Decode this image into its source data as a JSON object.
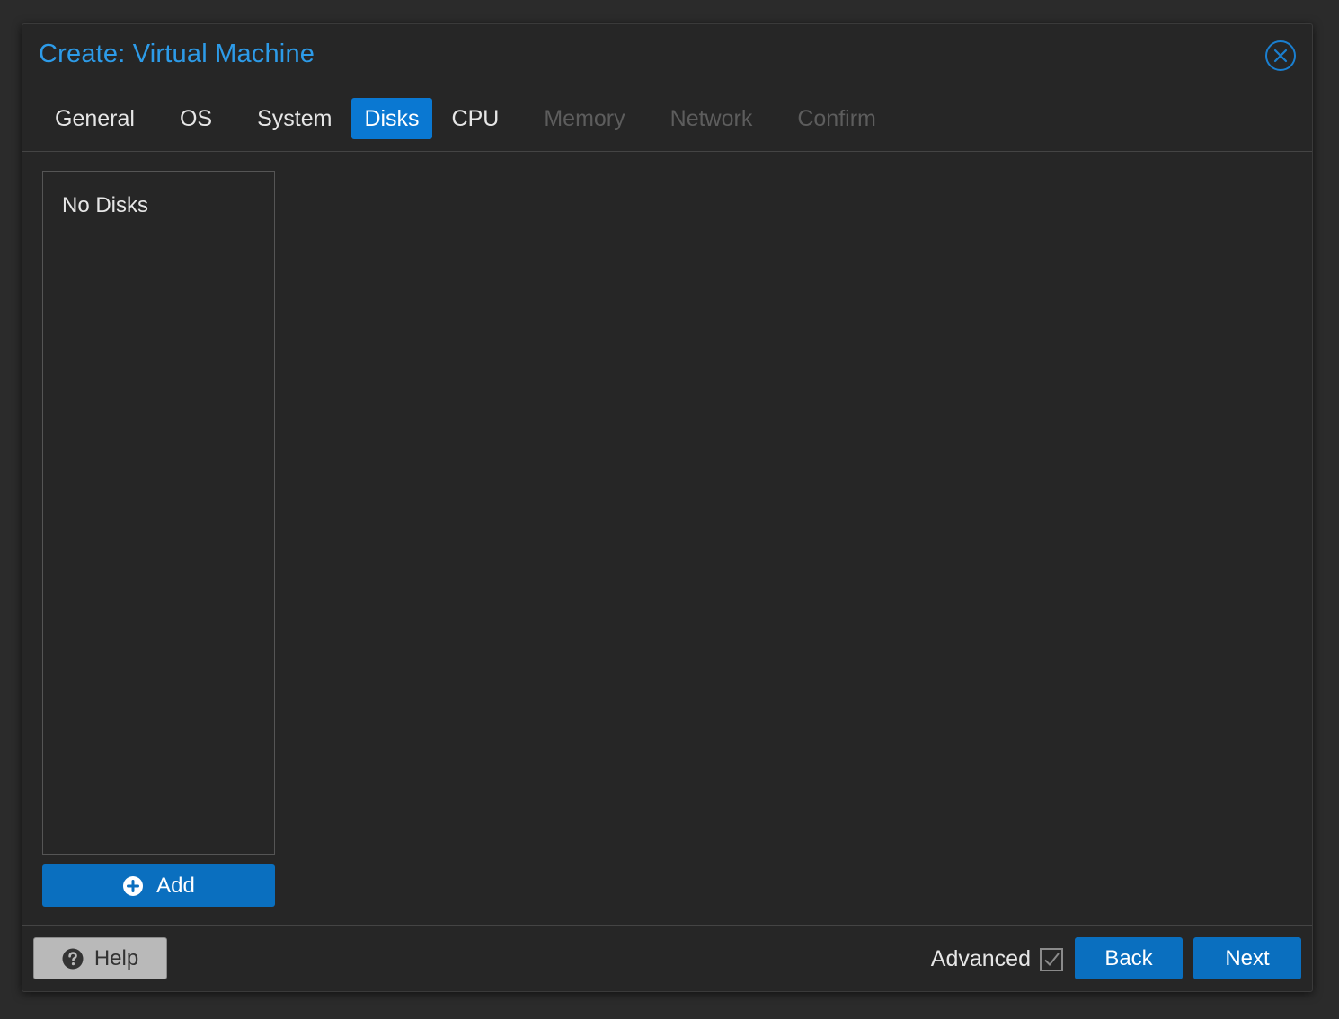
{
  "dialog": {
    "title": "Create: Virtual Machine",
    "close_icon": "close-circle-icon"
  },
  "tabs": [
    {
      "label": "General",
      "state": "done"
    },
    {
      "label": "OS",
      "state": "done"
    },
    {
      "label": "System",
      "state": "done"
    },
    {
      "label": "Disks",
      "state": "active"
    },
    {
      "label": "CPU",
      "state": "enabled"
    },
    {
      "label": "Memory",
      "state": "disabled"
    },
    {
      "label": "Network",
      "state": "disabled"
    },
    {
      "label": "Confirm",
      "state": "disabled"
    }
  ],
  "disks": {
    "empty_text": "No Disks",
    "add_label": "Add",
    "add_icon": "plus-circle-icon"
  },
  "footer": {
    "help_label": "Help",
    "help_icon": "question-circle-icon",
    "advanced_label": "Advanced",
    "advanced_checked": true,
    "back_label": "Back",
    "next_label": "Next"
  },
  "colors": {
    "accent": "#0a78d2",
    "title": "#2d9be8",
    "background": "#262626",
    "disabled_text": "#5d5d5d"
  }
}
